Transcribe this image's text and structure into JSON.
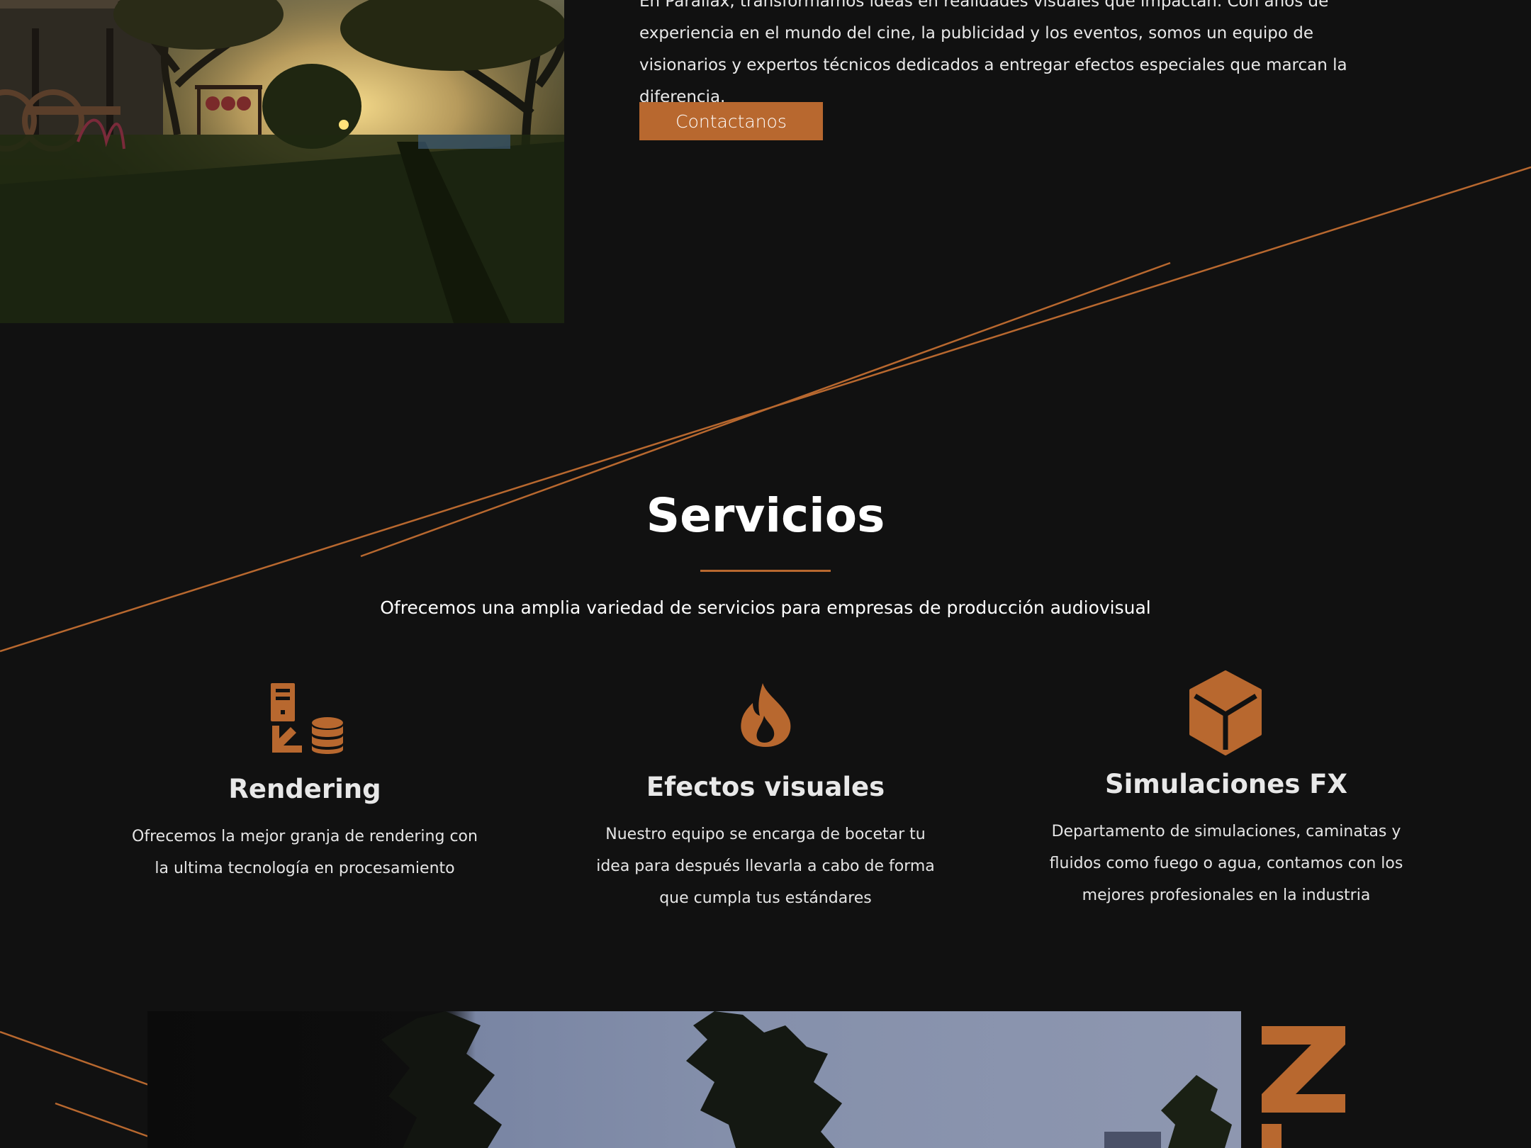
{
  "about": {
    "paragraph": "En Parallax, transformamos ideas en realidades visuales que impactan. Con años de experiencia en el mundo del cine, la publicidad y los eventos, somos un equipo de visionarios y expertos técnicos dedicados a entregar efectos especiales que marcan la diferencia.",
    "contact_button": "Contactanos"
  },
  "services": {
    "title": "Servicios",
    "subtitle": "Ofrecemos una amplia variedad de servicios para empresas de producción audiovisual",
    "items": [
      {
        "icon": "server-database-icon",
        "title": "Rendering",
        "description": "Ofrecemos la mejor granja de rendering con la ultima tecnología en procesamiento"
      },
      {
        "icon": "fire-icon",
        "title": "Efectos visuales",
        "description": "Nuestro equipo se encarga de bocetar tu idea para después llevarla a cabo de forma que cumpla tus estándares"
      },
      {
        "icon": "cube-icon",
        "title": "Simulaciones FX",
        "description": "Departamento de simulaciones, caminatas y fluidos como fuego o agua, contamos con los mejores profesionales en la industria"
      }
    ]
  },
  "colors": {
    "accent": "#b8682f",
    "background": "#111111",
    "text": "#ffffff"
  }
}
